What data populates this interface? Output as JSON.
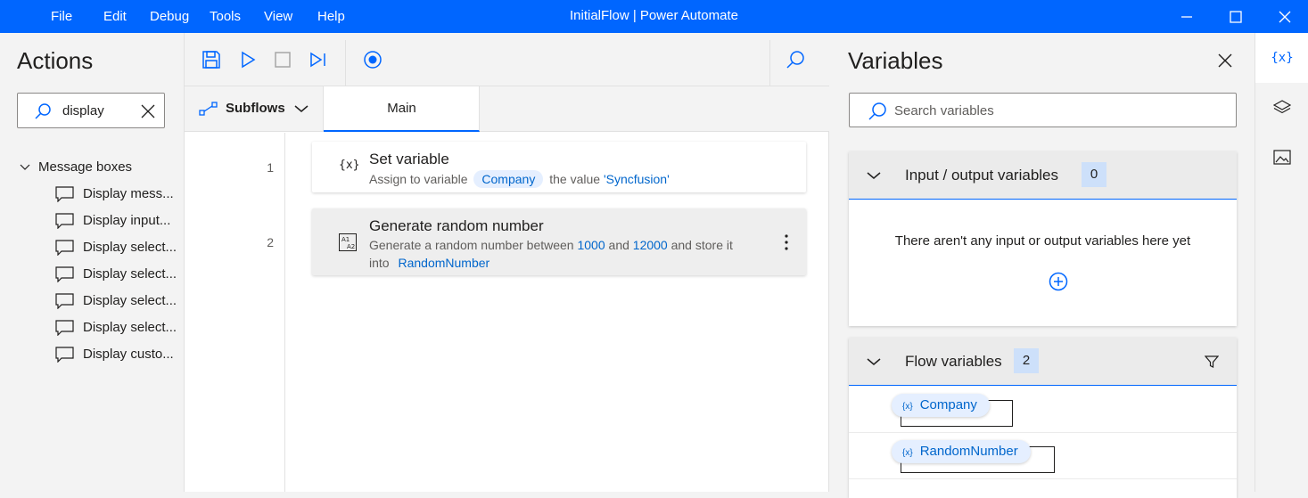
{
  "titlebar": {
    "menu": [
      "File",
      "Edit",
      "Debug",
      "Tools",
      "View",
      "Help"
    ],
    "title": "InitialFlow | Power Automate"
  },
  "actions": {
    "title": "Actions",
    "search_value": "display",
    "group": "Message boxes",
    "items": [
      "Display mess...",
      "Display input...",
      "Display select...",
      "Display select...",
      "Display select...",
      "Display select...",
      "Display custo..."
    ]
  },
  "designer": {
    "subflows_label": "Subflows",
    "main_tab": "Main",
    "steps": [
      {
        "line": "1",
        "title": "Set variable",
        "desc_prefix": "Assign to variable",
        "variable": "Company",
        "desc_mid": "the value",
        "value": "'Syncfusion'"
      },
      {
        "line": "2",
        "title": "Generate random number",
        "desc_prefix": "Generate a random number between",
        "min": "1000",
        "and": "and",
        "max": "12000",
        "desc_mid": "and store it",
        "into": "into",
        "variable": "RandomNumber"
      }
    ]
  },
  "variables": {
    "title": "Variables",
    "search_placeholder": "Search variables",
    "io_section": {
      "label": "Input / output variables",
      "count": "0",
      "empty_text": "There aren't any input or output variables here yet"
    },
    "flow_section": {
      "label": "Flow variables",
      "count": "2",
      "items": [
        "Company",
        "RandomNumber"
      ],
      "item_prefix": "{x}"
    }
  },
  "colors": {
    "accent": "#0066ff",
    "token": "#0066cc",
    "pill_bg": "#e5efff"
  },
  "icons": {
    "variable_step": "{x}",
    "random_step": "A1A2",
    "rail_variables": "{x}"
  }
}
